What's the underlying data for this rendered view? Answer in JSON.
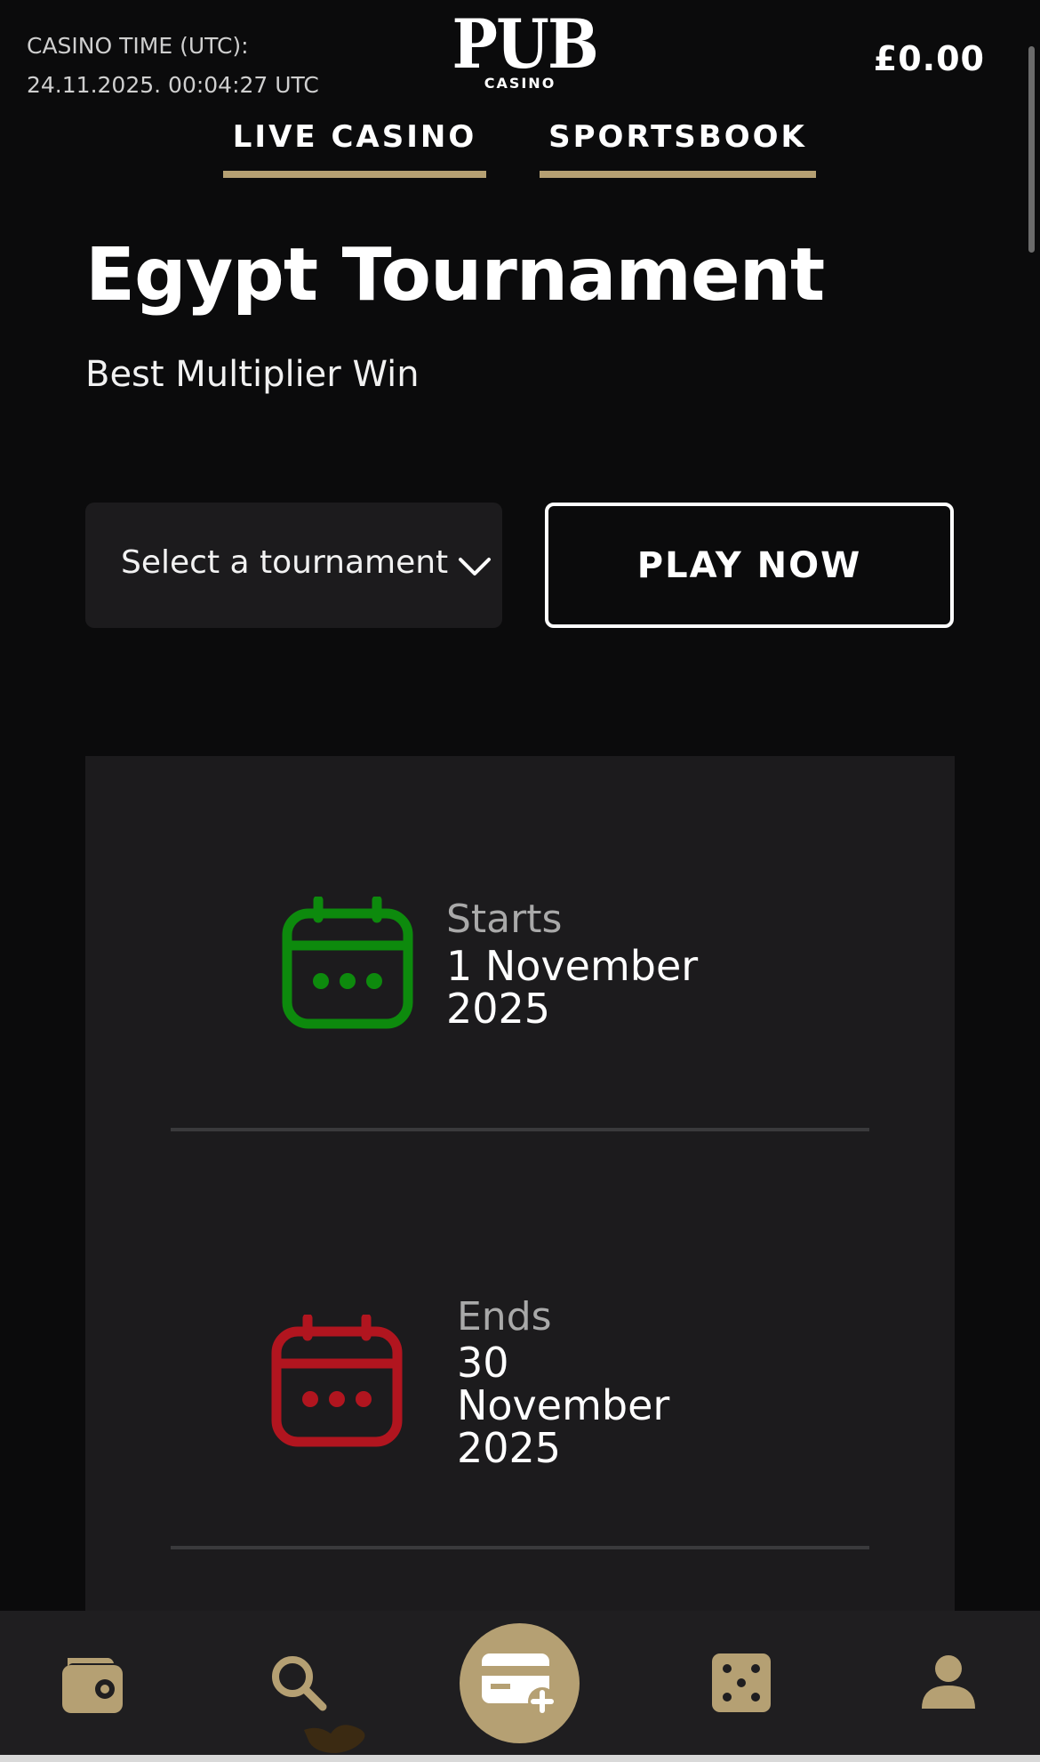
{
  "header": {
    "casino_time_label": "CASINO TIME (UTC):",
    "casino_time_value": "24.11.2025. 00:04:27 UTC",
    "logo_main": "PUB",
    "logo_sub": "CASINO",
    "balance": "£0.00"
  },
  "nav": {
    "live_casino": "LIVE CASINO",
    "sportsbook": "SPORTSBOOK"
  },
  "tournament": {
    "title": "Egypt Tournament",
    "subtitle": "Best Multiplier Win",
    "select_placeholder": "Select a tournament",
    "play_button": "PLAY NOW"
  },
  "info": {
    "start_label": "Starts",
    "start_value": "1 November 2025",
    "end_label": "Ends",
    "end_value": "30 November 2025"
  },
  "icons": {
    "start": "calendar-icon",
    "end": "calendar-icon",
    "wallet": "wallet-icon",
    "search": "search-icon",
    "deposit": "card-add-icon",
    "games": "dice-icon",
    "profile": "user-icon"
  },
  "colors": {
    "background": "#0b0b0c",
    "card": "#1c1b1d",
    "accent_gold": "#b5a073",
    "start_green": "#0d8a0d",
    "end_red": "#b1151f"
  }
}
